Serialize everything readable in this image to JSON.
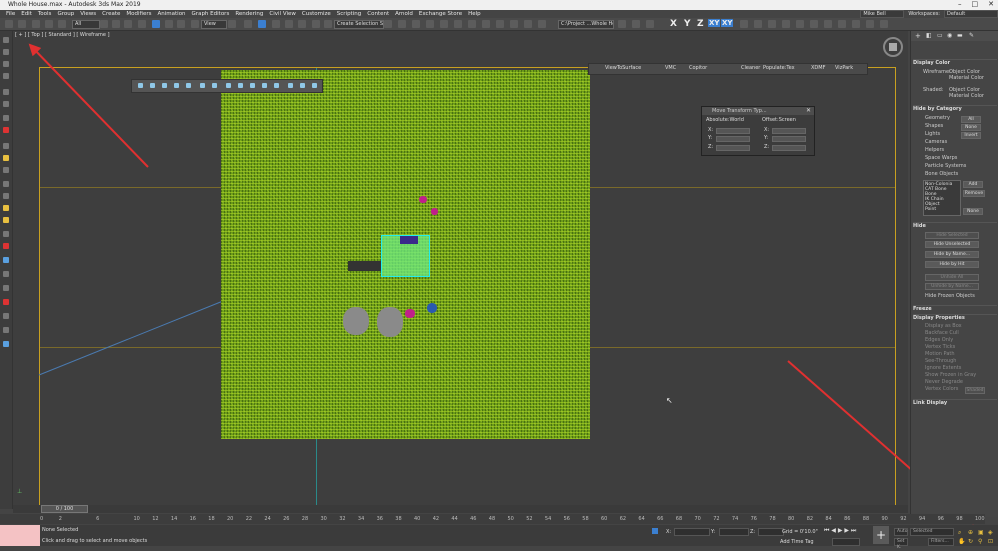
{
  "window": {
    "title": "Whole House.max - Autodesk 3ds Max 2019",
    "workspace_label": "Workspaces:",
    "workspace_value": "Default",
    "user": "Mike Bell"
  },
  "menu": [
    "File",
    "Edit",
    "Tools",
    "Group",
    "Views",
    "Create",
    "Modifiers",
    "Animation",
    "Graph Editors",
    "Rendering",
    "Civil View",
    "Customize",
    "Scripting",
    "Content",
    "Arnold",
    "Exchange Store",
    "Help"
  ],
  "toolbar": {
    "filter": "All",
    "view": "View",
    "selection_set": "Create Selection Set",
    "project": "C:\\Project ...Whole House",
    "axes": [
      "X",
      "Y",
      "Z",
      "XY",
      "XY"
    ]
  },
  "viewport": {
    "label": "[ + ] [ Top ] [ Standard ] [ Wireframe ]",
    "tool_items": [
      "ViewToSurface",
      "VMC",
      "Copitor",
      "Cleaner",
      "Populate:Tex",
      "XDMF",
      "VizPark"
    ]
  },
  "move_dialog": {
    "title": "Move Transform Typ...",
    "abs_label": "Absolute:World",
    "offset_label": "Offset:Screen",
    "x": "X:",
    "y": "Y:",
    "z": "Z:"
  },
  "panel": {
    "display_color": {
      "header": "Display Color",
      "wireframe": "Wireframe:",
      "shaded": "Shaded:",
      "object_color": "Object Color",
      "material_color": "Material Color"
    },
    "hide_by_category": {
      "header": "Hide by Category",
      "items": [
        "Geometry",
        "Shapes",
        "Lights",
        "Cameras",
        "Helpers",
        "Space Warps",
        "Particle Systems",
        "Bone Objects"
      ],
      "all": "All",
      "none": "None",
      "invert": "Invert",
      "list": [
        "Non-Colonia",
        "CAT Bone",
        "Bone",
        "IK Chain Object",
        "Point"
      ],
      "add": "Add",
      "remove": "Remove",
      "none2": "None"
    },
    "hide": {
      "header": "Hide",
      "buttons": [
        "Hide Selected",
        "Hide Unselected",
        "Hide by Name...",
        "Hide by Hit",
        "Unhide All",
        "Unhide by Name..."
      ],
      "frozen": "Hide Frozen Objects"
    },
    "freeze": {
      "header": "Freeze"
    },
    "display_properties": {
      "header": "Display Properties",
      "items": [
        "Display as Box",
        "Backface Cull",
        "Edges Only",
        "Vertex Ticks",
        "Motion Path",
        "See-Through",
        "Ignore Extents",
        "Show Frozen in Gray",
        "Never Degrade",
        "Vertex Colors"
      ],
      "shaded": "Shaded"
    },
    "link_display": {
      "header": "Link Display"
    }
  },
  "timeline": {
    "slider": "0 / 100",
    "ticks": [
      0,
      2,
      6,
      10,
      12,
      14,
      16,
      18,
      20,
      22,
      24,
      26,
      28,
      30,
      32,
      34,
      36,
      38,
      40,
      42,
      44,
      46,
      48,
      50,
      52,
      54,
      56,
      58,
      60,
      62,
      64,
      66,
      68,
      70,
      72,
      74,
      76,
      78,
      80,
      82,
      84,
      86,
      88,
      90,
      92,
      94,
      96,
      98,
      100
    ]
  },
  "status": {
    "line1": "None Selected",
    "line2": "Click and drag to select and move objects",
    "x": "X:",
    "y": "Y:",
    "z": "Z:",
    "grid": "Grid = 0'10.0\"",
    "add_time_tag": "Add Time Tag",
    "auto": "Auto",
    "setk": "Set K.",
    "selected": "Selected",
    "filters": "Filters..."
  }
}
